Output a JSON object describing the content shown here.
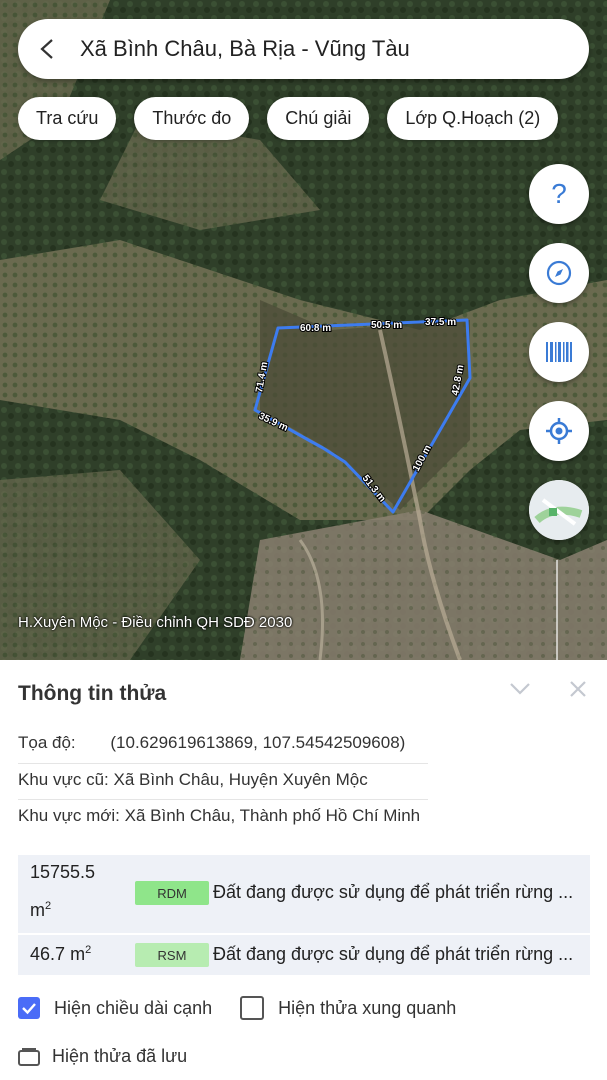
{
  "header": {
    "title": "Xã Bình Châu, Bà Rịa - Vũng Tàu"
  },
  "chips": [
    "Tra cứu",
    "Thước đo",
    "Chú giải",
    "Lớp Q.Hoạch (2)"
  ],
  "fab_icons": [
    "help-icon",
    "compass-icon",
    "barcode-icon",
    "location-icon",
    "map-thumbnail-icon"
  ],
  "map": {
    "caption": "H.Xuyên Mộc - Điều chỉnh QH SDĐ 2030",
    "edge_labels": [
      "60.8 m",
      "50.5 m",
      "37.5 m",
      "42.8 m",
      "100 m",
      "51.3 m",
      "35.9 m",
      "71.4 m"
    ]
  },
  "panel": {
    "title": "Thông tin thửa",
    "coordinates_label": "Tọa độ:",
    "coordinates_value": "(10.629619613869, 107.54542509608)",
    "old_area_label": "Khu vực cũ:",
    "old_area_value": "Xã Bình Châu, Huyện Xuyên Mộc",
    "new_area_label": "Khu vực mới:",
    "new_area_value": "Xã Bình Châu, Thành phố Hồ Chí Minh",
    "land_rows": [
      {
        "area_value": "15755.5",
        "area_unit": "m",
        "code": "RDM",
        "code_color": "#8fe58a",
        "description": "Đất đang được sử dụng để phát triển rừng ..."
      },
      {
        "area_value": "46.7",
        "area_unit": "m",
        "code": "RSM",
        "code_color": "#b7ecb1",
        "description": "Đất đang được sử dụng để phát triển rừng ..."
      }
    ],
    "show_edge_length": {
      "label": "Hiện chiều dài cạnh",
      "checked": true
    },
    "show_surrounding": {
      "label": "Hiện thửa xung quanh",
      "checked": false
    },
    "saved_label": "Hiện thửa đã lưu"
  },
  "colors": {
    "accent": "#4a6cf7",
    "boundary": "#3d7cf0",
    "fab_icon": "#3a7bd5"
  }
}
